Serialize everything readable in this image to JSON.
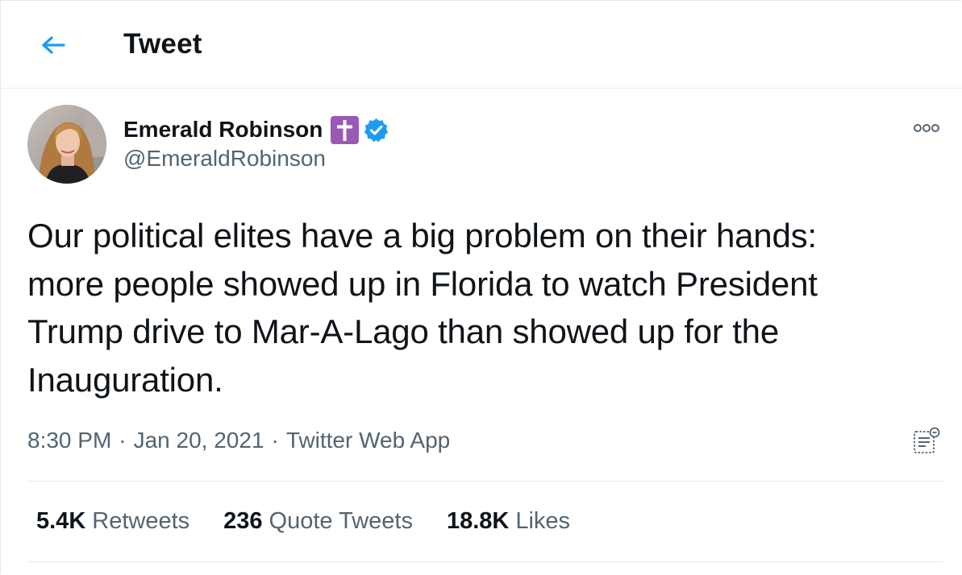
{
  "header": {
    "title": "Tweet"
  },
  "tweet": {
    "author": {
      "display_name": "Emerald Robinson",
      "handle": "@EmeraldRobinson",
      "badges": [
        "latin-cross-emoji",
        "verified-badge-icon"
      ]
    },
    "text": "Our political elites have a big problem on their hands:\nmore people showed up in Florida to watch President\nTrump drive to Mar-A-Lago than showed up for the\nInauguration.",
    "meta": {
      "time": "8:30 PM",
      "date": "Jan 20, 2021",
      "source": "Twitter Web App",
      "separator": "·"
    },
    "stats": {
      "retweets": {
        "count": "5.4K",
        "label": "Retweets"
      },
      "quote_tweets": {
        "count": "236",
        "label": "Quote Tweets"
      },
      "likes": {
        "count": "18.8K",
        "label": "Likes"
      }
    }
  },
  "colors": {
    "accent": "#1d9bf0",
    "secondary_text": "#536471",
    "primary_text": "#0f1419",
    "cross_badge": "#9b59b6",
    "divider": "#e6ecf0"
  },
  "icons": [
    "back-arrow-icon",
    "more-icon",
    "analytics-icon",
    "verified-badge-icon",
    "cross-emoji-icon"
  ]
}
